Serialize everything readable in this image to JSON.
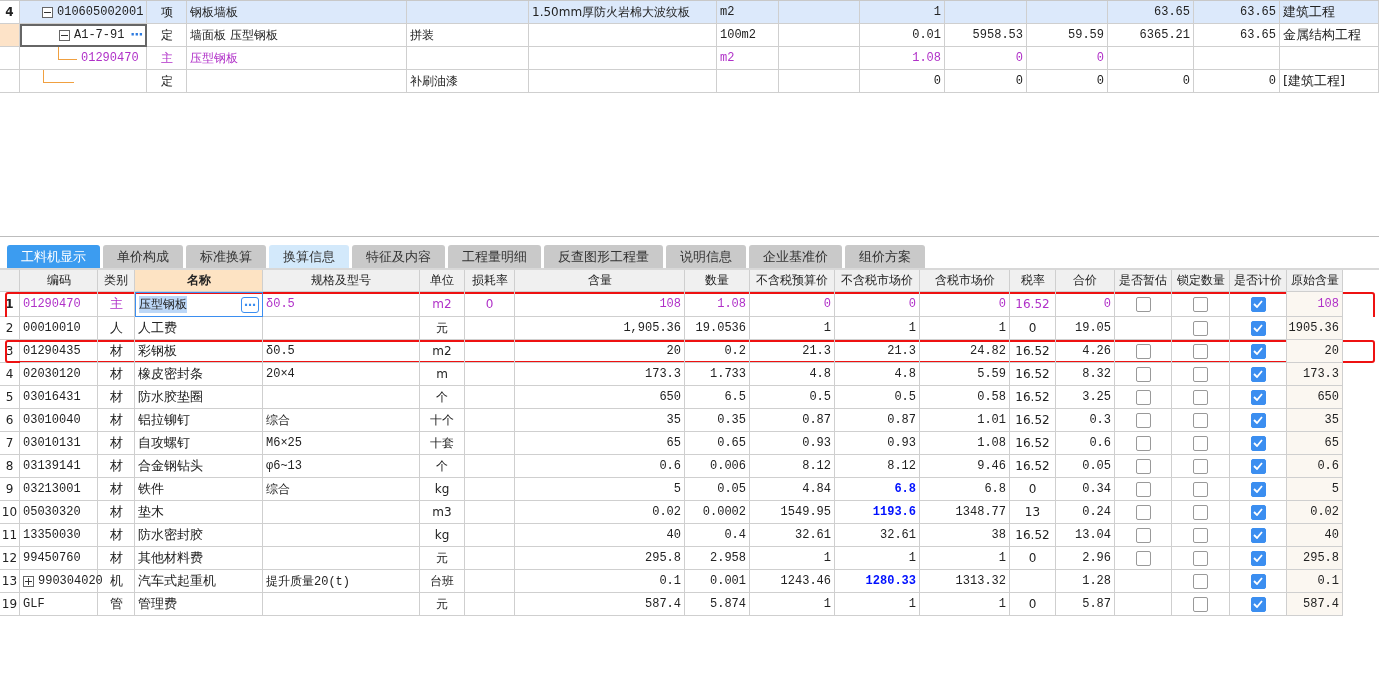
{
  "upper_grid": {
    "rows": [
      {
        "num": "4",
        "code": "010605002001",
        "type": "项",
        "name": "钢板墙板",
        "column_6": "1.50mm厚防火岩棉大波纹板",
        "unit": "m2",
        "column_9": "1",
        "column_12": "63.65",
        "column_13": "63.65",
        "column_14": "建筑工程",
        "selected": true,
        "focused": false,
        "main": false,
        "expanded": true,
        "children": [
          {
            "code": "A1-7-91",
            "edit_button": "⋯",
            "type": "定",
            "name": "墙面板 压型钢板",
            "spec": "拼装",
            "unit": "100m2",
            "column_9": "0.01",
            "column_10": "5958.53",
            "column_11": "59.59",
            "column_12": "6365.21",
            "column_13": "63.65",
            "column_14": "金属结构工程",
            "selected": false,
            "focused": true,
            "main": false,
            "expanded": true,
            "children": [
              {
                "code": "01290470",
                "type": "主",
                "name": "压型钢板",
                "unit": "m2",
                "column_9": "1.08",
                "column_10": "0",
                "column_11": "0",
                "selected": false,
                "focused": false,
                "main": true
              }
            ]
          },
          {
            "type": "定",
            "spec": "补刷油漆",
            "column_9": "0",
            "column_10": "0",
            "column_11": "0",
            "column_12": "0",
            "column_13": "0",
            "column_14": "[建筑工程]",
            "selected": false,
            "focused": false,
            "main": false
          }
        ]
      }
    ]
  },
  "tabs": [
    {
      "label": "工料机显示",
      "selected": true,
      "hovered": false
    },
    {
      "label": "单价构成",
      "selected": false,
      "hovered": false
    },
    {
      "label": "标准换算",
      "selected": false,
      "hovered": false
    },
    {
      "label": "换算信息",
      "selected": false,
      "hovered": true
    },
    {
      "label": "特征及内容",
      "selected": false,
      "hovered": false
    },
    {
      "label": "工程量明细",
      "selected": false,
      "hovered": false
    },
    {
      "label": "反查图形工程量",
      "selected": false,
      "hovered": false
    },
    {
      "label": "说明信息",
      "selected": false,
      "hovered": false
    },
    {
      "label": "企业基准价",
      "selected": false,
      "hovered": false
    },
    {
      "label": "组价方案",
      "selected": false,
      "hovered": false
    }
  ],
  "table": {
    "columns": [
      {
        "label": "编码",
        "sorted": false
      },
      {
        "label": "类别",
        "sorted": false
      },
      {
        "label": "名称",
        "sorted": true
      },
      {
        "label": "规格及型号",
        "sorted": false
      },
      {
        "label": "单位",
        "sorted": false
      },
      {
        "label": "损耗率",
        "sorted": false
      },
      {
        "label": "含量",
        "sorted": false
      },
      {
        "label": "数量",
        "sorted": false
      },
      {
        "label": "不含税预算价",
        "sorted": false
      },
      {
        "label": "不含税市场价",
        "sorted": false
      },
      {
        "label": "含税市场价",
        "sorted": false
      },
      {
        "label": "税率",
        "sorted": false
      },
      {
        "label": "合价",
        "sorted": false
      },
      {
        "label": "是否暂估",
        "sorted": false
      },
      {
        "label": "锁定数量",
        "sorted": false
      },
      {
        "label": "是否计价",
        "sorted": false
      },
      {
        "label": "原始含量",
        "sorted": false
      }
    ],
    "rows": [
      {
        "num": "1",
        "code": "01290470",
        "type": "主",
        "name": "压型钢板",
        "edit_button": "⋯",
        "spec": "δ0.5",
        "unit": "m2",
        "loss": "0",
        "content": "108",
        "qty": "1.08",
        "budget_price": "0",
        "market_price": "0",
        "tax_market_price": "0",
        "tax_rate": "16.52",
        "total": "0",
        "estimate": false,
        "locked": false,
        "priced": true,
        "original": "108",
        "main": true,
        "selected": true,
        "market_modified": false,
        "highlighted": true,
        "expandable": false
      },
      {
        "num": "2",
        "code": "00010010",
        "type": "人",
        "name": "人工费",
        "unit": "元",
        "content": "1,905.36",
        "qty": "19.0536",
        "budget_price": "1",
        "market_price": "1",
        "tax_market_price": "1",
        "tax_rate": "0",
        "total": "19.05",
        "locked": false,
        "priced": true,
        "original": "1905.36",
        "main": false,
        "selected": false,
        "market_modified": false,
        "highlighted": false,
        "expandable": false
      },
      {
        "num": "3",
        "code": "01290435",
        "type": "材",
        "name": "彩钢板",
        "spec": "δ0.5",
        "unit": "m2",
        "content": "20",
        "qty": "0.2",
        "budget_price": "21.3",
        "market_price": "21.3",
        "tax_market_price": "24.82",
        "tax_rate": "16.52",
        "total": "4.26",
        "estimate": false,
        "locked": false,
        "priced": true,
        "original": "20",
        "main": false,
        "selected": false,
        "market_modified": false,
        "highlighted": true,
        "expandable": false
      },
      {
        "num": "4",
        "code": "02030120",
        "type": "材",
        "name": "橡皮密封条",
        "spec": "20×4",
        "unit": "m",
        "content": "173.3",
        "qty": "1.733",
        "budget_price": "4.8",
        "market_price": "4.8",
        "tax_market_price": "5.59",
        "tax_rate": "16.52",
        "total": "8.32",
        "estimate": false,
        "locked": false,
        "priced": true,
        "original": "173.3",
        "main": false,
        "selected": false,
        "market_modified": false,
        "highlighted": false,
        "expandable": false
      },
      {
        "num": "5",
        "code": "03016431",
        "type": "材",
        "name": "防水胶垫圈",
        "unit": "个",
        "content": "650",
        "qty": "6.5",
        "budget_price": "0.5",
        "market_price": "0.5",
        "tax_market_price": "0.58",
        "tax_rate": "16.52",
        "total": "3.25",
        "estimate": false,
        "locked": false,
        "priced": true,
        "original": "650",
        "main": false,
        "selected": false,
        "market_modified": false,
        "highlighted": false,
        "expandable": false
      },
      {
        "num": "6",
        "code": "03010040",
        "type": "材",
        "name": "铝拉铆钉",
        "spec": "综合",
        "unit": "十个",
        "content": "35",
        "qty": "0.35",
        "budget_price": "0.87",
        "market_price": "0.87",
        "tax_market_price": "1.01",
        "tax_rate": "16.52",
        "total": "0.3",
        "estimate": false,
        "locked": false,
        "priced": true,
        "original": "35",
        "main": false,
        "selected": false,
        "market_modified": false,
        "highlighted": false,
        "expandable": false
      },
      {
        "num": "7",
        "code": "03010131",
        "type": "材",
        "name": "自攻螺钉",
        "spec": "M6×25",
        "unit": "十套",
        "content": "65",
        "qty": "0.65",
        "budget_price": "0.93",
        "market_price": "0.93",
        "tax_market_price": "1.08",
        "tax_rate": "16.52",
        "total": "0.6",
        "estimate": false,
        "locked": false,
        "priced": true,
        "original": "65",
        "main": false,
        "selected": false,
        "market_modified": false,
        "highlighted": false,
        "expandable": false
      },
      {
        "num": "8",
        "code": "03139141",
        "type": "材",
        "name": "合金钢钻头",
        "spec": "φ6~13",
        "unit": "个",
        "content": "0.6",
        "qty": "0.006",
        "budget_price": "8.12",
        "market_price": "8.12",
        "tax_market_price": "9.46",
        "tax_rate": "16.52",
        "total": "0.05",
        "estimate": false,
        "locked": false,
        "priced": true,
        "original": "0.6",
        "main": false,
        "selected": false,
        "market_modified": false,
        "highlighted": false,
        "expandable": false
      },
      {
        "num": "9",
        "code": "03213001",
        "type": "材",
        "name": "铁件",
        "spec": "综合",
        "unit": "kg",
        "content": "5",
        "qty": "0.05",
        "budget_price": "4.84",
        "market_price": "6.8",
        "tax_market_price": "6.8",
        "tax_rate": "0",
        "total": "0.34",
        "estimate": false,
        "locked": false,
        "priced": true,
        "original": "5",
        "main": false,
        "selected": false,
        "market_modified": true,
        "highlighted": false,
        "expandable": false
      },
      {
        "num": "10",
        "code": "05030320",
        "type": "材",
        "name": "垫木",
        "unit": "m3",
        "content": "0.02",
        "qty": "0.0002",
        "budget_price": "1549.95",
        "market_price": "1193.6",
        "tax_market_price": "1348.77",
        "tax_rate": "13",
        "total": "0.24",
        "estimate": false,
        "locked": false,
        "priced": true,
        "original": "0.02",
        "main": false,
        "selected": false,
        "market_modified": true,
        "highlighted": false,
        "expandable": false
      },
      {
        "num": "11",
        "code": "13350030",
        "type": "材",
        "name": "防水密封胶",
        "unit": "kg",
        "content": "40",
        "qty": "0.4",
        "budget_price": "32.61",
        "market_price": "32.61",
        "tax_market_price": "38",
        "tax_rate": "16.52",
        "total": "13.04",
        "estimate": false,
        "locked": false,
        "priced": true,
        "original": "40",
        "main": false,
        "selected": false,
        "market_modified": false,
        "highlighted": false,
        "expandable": false
      },
      {
        "num": "12",
        "code": "99450760",
        "type": "材",
        "name": "其他材料费",
        "unit": "元",
        "content": "295.8",
        "qty": "2.958",
        "budget_price": "1",
        "market_price": "1",
        "tax_market_price": "1",
        "tax_rate": "0",
        "total": "2.96",
        "estimate": false,
        "locked": false,
        "priced": true,
        "original": "295.8",
        "main": false,
        "selected": false,
        "market_modified": false,
        "highlighted": false,
        "expandable": false
      },
      {
        "num": "13",
        "code": "990304020",
        "type": "机",
        "name": "汽车式起重机",
        "spec": "提升质量20(t)",
        "unit": "台班",
        "content": "0.1",
        "qty": "0.001",
        "budget_price": "1243.46",
        "market_price": "1280.33",
        "tax_market_price": "1313.32",
        "total": "1.28",
        "locked": false,
        "priced": true,
        "original": "0.1",
        "main": false,
        "selected": false,
        "market_modified": true,
        "highlighted": false,
        "expandable": true
      },
      {
        "num": "19",
        "code": "GLF",
        "type": "管",
        "name": "管理费",
        "unit": "元",
        "content": "587.4",
        "qty": "5.874",
        "budget_price": "1",
        "market_price": "1",
        "tax_market_price": "1",
        "tax_rate": "0",
        "total": "5.87",
        "locked": false,
        "priced": true,
        "original": "587.4",
        "main": false,
        "selected": false,
        "market_modified": false,
        "highlighted": false,
        "expandable": false
      }
    ]
  }
}
